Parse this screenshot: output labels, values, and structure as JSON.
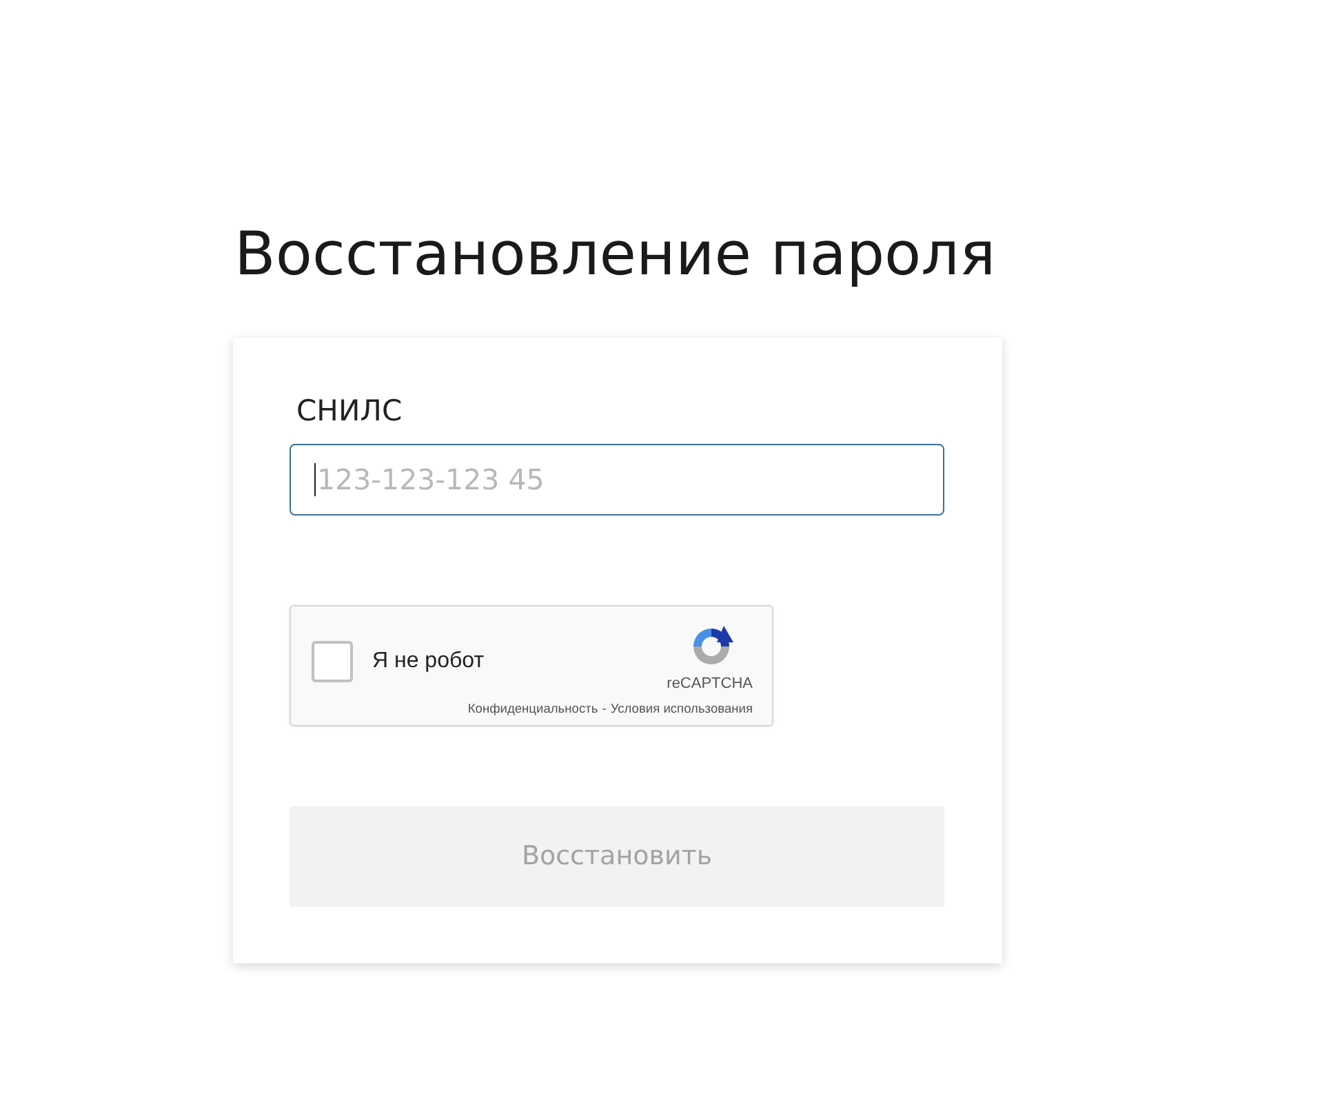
{
  "page": {
    "title": "Восстановление пароля"
  },
  "form": {
    "snils_field": {
      "label": "СНИЛС",
      "placeholder": "123-123-123 45",
      "focused": true
    },
    "captcha": {
      "label": "Я не робот",
      "checked": false,
      "brand": "reCAPTCHA",
      "links": [
        "Конфиденциальность",
        "Условия использования"
      ],
      "separator": "-"
    },
    "submit_button": {
      "label": "Восстановить",
      "disabled": true
    }
  }
}
